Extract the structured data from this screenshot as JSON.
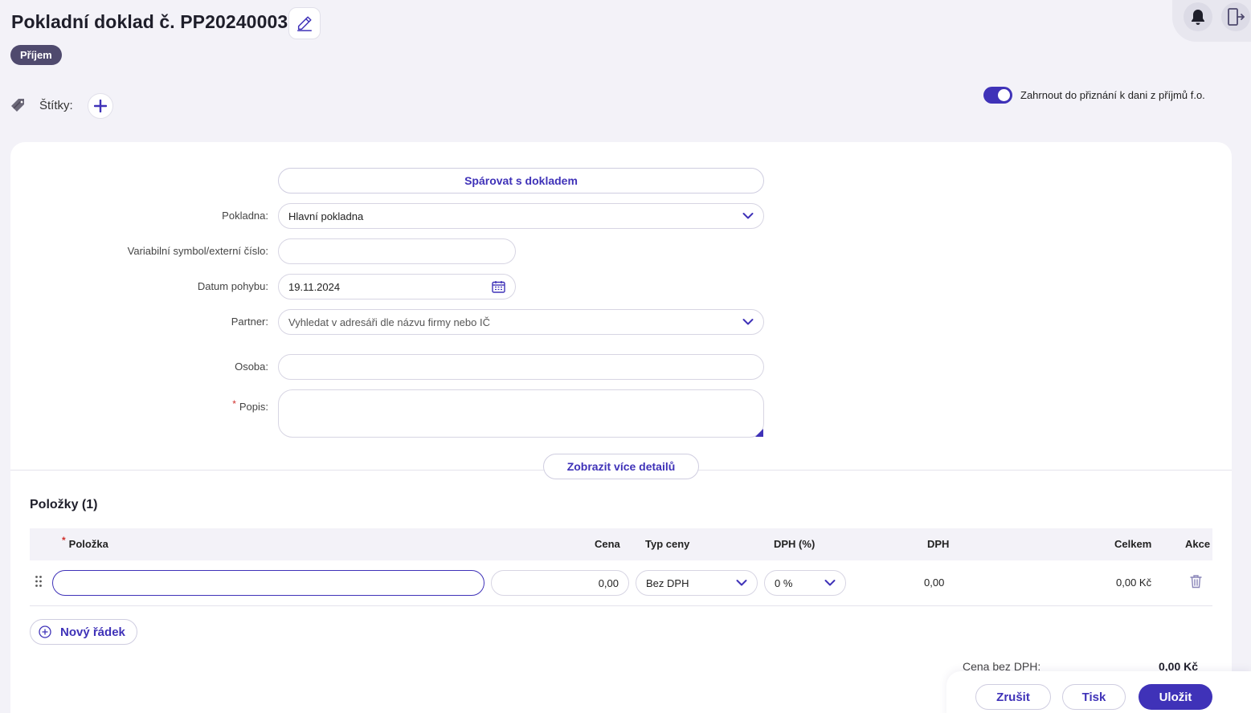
{
  "header": {
    "title": "Pokladní doklad č. PP20240003",
    "badge": "Příjem"
  },
  "labels": {
    "tags_label": "Štítky:",
    "toggle_label": "Zahrnout do přiznání k dani z příjmů f.o.",
    "toggle_on": true
  },
  "form": {
    "pair_button": "Spárovat s dokladem",
    "pokladna_label": "Pokladna:",
    "pokladna_value": "Hlavní pokladna",
    "vs_label": "Variabilní symbol/externí číslo:",
    "vs_value": "",
    "datum_label": "Datum pohybu:",
    "datum_value": "19.11.2024",
    "partner_label": "Partner:",
    "partner_placeholder": "Vyhledat v adresáři dle názvu firmy nebo IČ",
    "osoba_label": "Osoba:",
    "osoba_value": "",
    "popis_label": "Popis:",
    "popis_value": "",
    "more_details_button": "Zobrazit více detailů"
  },
  "items": {
    "title": "Položky (1)",
    "columns": {
      "item": "Položka",
      "price": "Cena",
      "price_type": "Typ ceny",
      "vat_rate": "DPH (%)",
      "vat": "DPH",
      "total": "Celkem",
      "actions": "Akce"
    },
    "rows": [
      {
        "item": "",
        "price": "0,00",
        "price_type": "Bez DPH",
        "vat_rate": "0 %",
        "vat": "0,00",
        "total": "0,00 Kč"
      }
    ],
    "new_row_button": "Nový řádek"
  },
  "summary": {
    "net_label": "Cena bez DPH:",
    "net_value": "0,00 Kč"
  },
  "footer": {
    "cancel": "Zrušit",
    "print": "Tisk",
    "save": "Uložit"
  },
  "colors": {
    "accent": "#3f32b8",
    "badge": "#4f4a6e",
    "required": "#d0312d"
  }
}
